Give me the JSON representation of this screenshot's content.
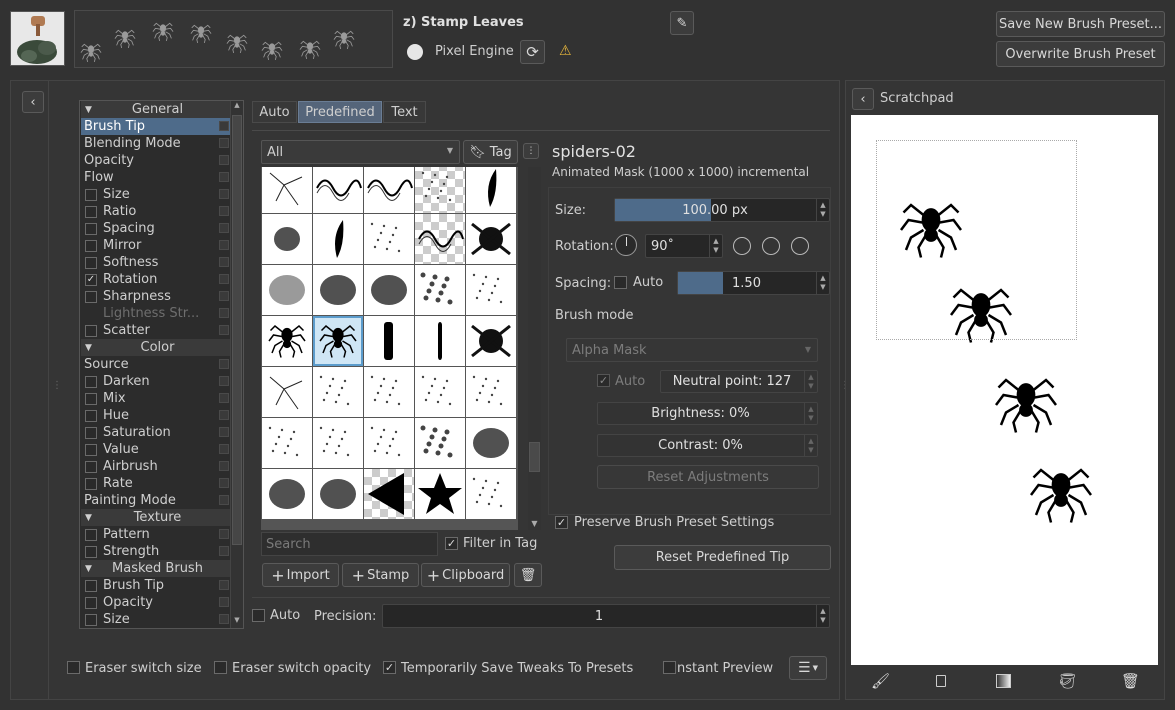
{
  "header": {
    "preset_name": "z) Stamp Leaves",
    "engine": "Pixel Engine",
    "save_new": "Save New Brush Preset...",
    "overwrite": "Overwrite Brush Preset"
  },
  "options": {
    "items": [
      {
        "label": "General",
        "kind": "group"
      },
      {
        "label": "Brush Tip",
        "kind": "selected"
      },
      {
        "label": "Blending Mode",
        "kind": "plain"
      },
      {
        "label": "Opacity",
        "kind": "plain"
      },
      {
        "label": "Flow",
        "kind": "plain"
      },
      {
        "label": "Size",
        "kind": "check",
        "checked": false
      },
      {
        "label": "Ratio",
        "kind": "check",
        "checked": false
      },
      {
        "label": "Spacing",
        "kind": "check",
        "checked": false
      },
      {
        "label": "Mirror",
        "kind": "check",
        "checked": false
      },
      {
        "label": "Softness",
        "kind": "check",
        "checked": false
      },
      {
        "label": "Rotation",
        "kind": "check",
        "checked": true
      },
      {
        "label": "Sharpness",
        "kind": "check",
        "checked": false
      },
      {
        "label": "Lightness Str...",
        "kind": "disabled"
      },
      {
        "label": "Scatter",
        "kind": "check",
        "checked": false
      },
      {
        "label": "Color",
        "kind": "group"
      },
      {
        "label": "Source",
        "kind": "plain"
      },
      {
        "label": "Darken",
        "kind": "check",
        "checked": false
      },
      {
        "label": "Mix",
        "kind": "check",
        "checked": false
      },
      {
        "label": "Hue",
        "kind": "check",
        "checked": false
      },
      {
        "label": "Saturation",
        "kind": "check",
        "checked": false
      },
      {
        "label": "Value",
        "kind": "check",
        "checked": false
      },
      {
        "label": "Airbrush",
        "kind": "check",
        "checked": false
      },
      {
        "label": "Rate",
        "kind": "check",
        "checked": false
      },
      {
        "label": "Painting Mode",
        "kind": "plain"
      },
      {
        "label": "Texture",
        "kind": "group"
      },
      {
        "label": "Pattern",
        "kind": "check",
        "checked": false
      },
      {
        "label": "Strength",
        "kind": "check",
        "checked": false
      },
      {
        "label": "Masked Brush",
        "kind": "group"
      },
      {
        "label": "Brush Tip",
        "kind": "check",
        "checked": false
      },
      {
        "label": "Opacity",
        "kind": "check",
        "checked": false
      },
      {
        "label": "Size",
        "kind": "check",
        "checked": false
      }
    ]
  },
  "tabs": {
    "auto": "Auto",
    "predefined": "Predefined",
    "text": "Text"
  },
  "filter": {
    "all": "All",
    "tag": "Tag"
  },
  "search": {
    "placeholder": "Search",
    "filter_in_tag": "Filter in Tag"
  },
  "actions": {
    "import": "Import",
    "stamp": "Stamp",
    "clipboard": "Clipboard"
  },
  "brush": {
    "name": "spiders-02",
    "info": "Animated Mask (1000 x 1000) incremental",
    "size_label": "Size:",
    "size_value": "100.00 px",
    "size_fraction": 0.45,
    "rotation_label": "Rotation:",
    "rotation_value": "90˚",
    "spacing_label": "Spacing:",
    "spacing_auto": "Auto",
    "spacing_value": "1.50",
    "spacing_fraction": 0.3,
    "brush_mode_label": "Brush mode",
    "mode_value": "Alpha Mask",
    "mode_auto": "Auto",
    "neutral": "Neutral point: 127",
    "brightness": "Brightness: 0%",
    "contrast": "Contrast: 0%",
    "reset_adj": "Reset Adjustments",
    "preserve": "Preserve Brush Preset Settings",
    "reset_tip": "Reset Predefined Tip"
  },
  "precision": {
    "auto": "Auto",
    "label": "Precision:",
    "value": "1"
  },
  "bottom": {
    "eraser_size": "Eraser switch size",
    "eraser_opacity": "Eraser switch opacity",
    "temp_save": "Temporarily Save Tweaks To Presets",
    "instant": "nstant Preview"
  },
  "scratchpad": {
    "title": "Scratchpad"
  }
}
